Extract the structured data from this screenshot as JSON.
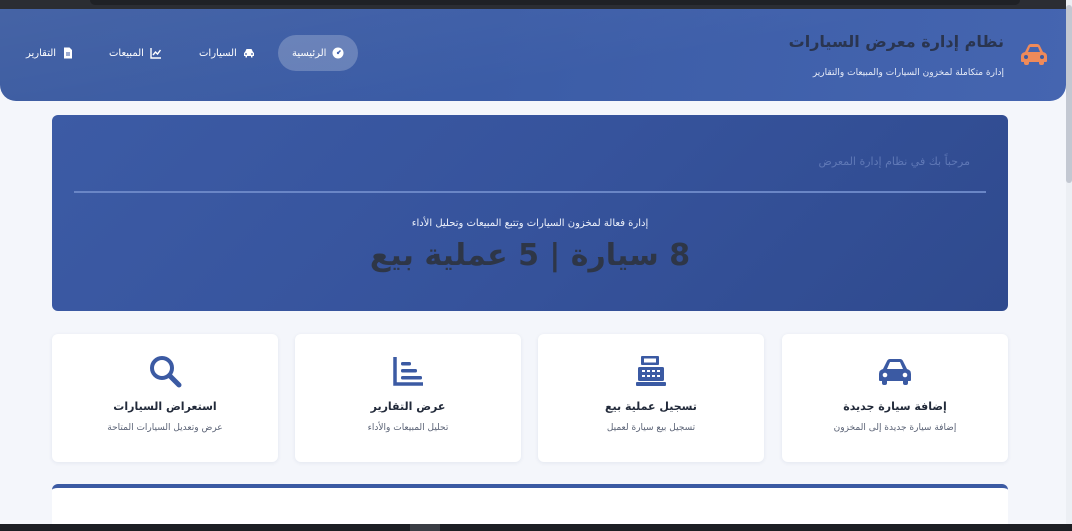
{
  "header": {
    "title": "نظام إدارة معرض السيارات",
    "subtitle": "إدارة متكاملة لمخزون السيارات والمبيعات والتقارير"
  },
  "nav": {
    "items": [
      {
        "label": "الرئيسية",
        "icon": "dashboard-icon",
        "active": true
      },
      {
        "label": "السيارات",
        "icon": "car-icon"
      },
      {
        "label": "المبيعات",
        "icon": "chart-line-icon"
      },
      {
        "label": "التقارير",
        "icon": "file-icon"
      }
    ]
  },
  "hero": {
    "welcome": "مرحباً بك في نظام إدارة المعرض",
    "description": "إدارة فعالة لمخزون السيارات وتتبع المبيعات وتحليل الأداء",
    "stats": "8 سيارة | 5 عملية بيع"
  },
  "cards": [
    {
      "title": "إضافة سيارة جديدة",
      "description": "إضافة سيارة جديدة إلى المخزون",
      "icon": "car-icon"
    },
    {
      "title": "تسجيل عملية بيع",
      "description": "تسجيل بيع سيارة لعميل",
      "icon": "cash-register-icon"
    },
    {
      "title": "عرض التقارير",
      "description": "تحليل المبيعات والأداء",
      "icon": "bar-chart-icon"
    },
    {
      "title": "استعراض السيارات",
      "description": "عرض وتعديل السيارات المتاحة",
      "icon": "search-icon"
    }
  ],
  "colors": {
    "primary": "#3b5aa3",
    "accent": "#e8743b",
    "dark_text": "#2a3550"
  }
}
